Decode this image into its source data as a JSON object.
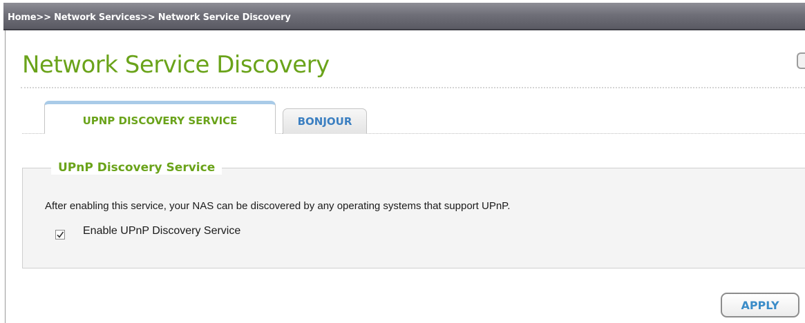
{
  "breadcrumb": {
    "text": "Home>> Network Services>> Network Service Discovery"
  },
  "page": {
    "title": "Network Service Discovery"
  },
  "tabs": [
    {
      "label": "UPNP DISCOVERY SERVICE",
      "active": true
    },
    {
      "label": "BONJOUR",
      "active": false
    }
  ],
  "upnp_section": {
    "legend": "UPnP Discovery Service",
    "description": "After enabling this service, your NAS can be discovered by any operating systems that support UPnP.",
    "checkbox_label": "Enable UPnP Discovery Service",
    "checkbox_checked": true
  },
  "actions": {
    "apply_label": "APPLY"
  },
  "colors": {
    "title_green": "#6aa31a",
    "tab_blue": "#3b7fc1",
    "breadcrumb_bar": "#6f6f78"
  },
  "icons": {
    "checkbox": "check-mark-icon",
    "scroll": "scroll-handle-icon"
  }
}
